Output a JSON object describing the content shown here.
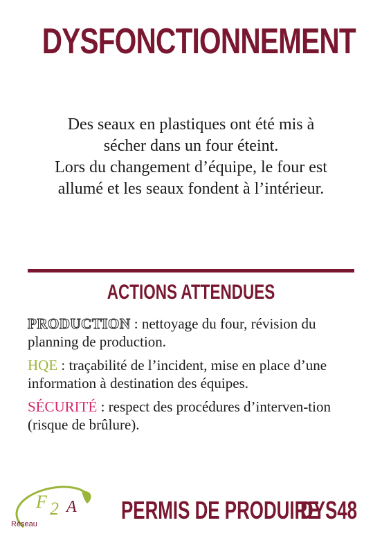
{
  "title": "DYSFONCTIONNEMENT",
  "description": [
    "Des seaux en plastiques ont été mis à",
    "sécher dans un four éteint.",
    "Lors du changement d’équipe, le four est",
    "allumé et les seaux fondent à l’intérieur."
  ],
  "section_title": "ACTIONS ATTENDUES",
  "actions": [
    {
      "tag": "PRODUCTION",
      "text": " : nettoyage du four, révision du planning de production.",
      "color": "#ffffff"
    },
    {
      "tag": "HQE",
      "text": " : traçabilité de l’incident, mise en place d’une information à destination des équipes.",
      "color": "#9ab53a"
    },
    {
      "tag": "SÉCURITÉ",
      "text": " : respect des procédures d’interven-tion (risque de brûlure).",
      "color": "#d6266a"
    }
  ],
  "footer": {
    "logo_mark": "F2A",
    "logo_network": "Réseau",
    "label": "PERMIS DE PRODUIRE",
    "code": "DYS48"
  },
  "colors": {
    "brand": "#7a1730",
    "hqe": "#9ab53a",
    "securite": "#d6266a"
  }
}
